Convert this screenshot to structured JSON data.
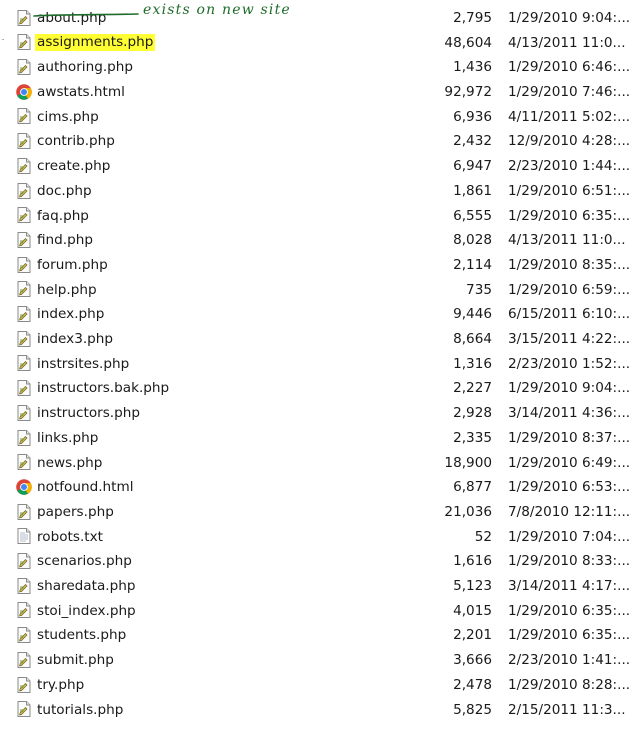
{
  "files": [
    {
      "name": "about.php",
      "size": "2,795",
      "date": "1/29/2010 9:04:...",
      "icon": "php-file-icon"
    },
    {
      "name": "assignments.php",
      "size": "48,604",
      "date": "4/13/2011 11:0...",
      "icon": "php-file-icon",
      "highlighted": true
    },
    {
      "name": "authoring.php",
      "size": "1,436",
      "date": "1/29/2010 6:46:...",
      "icon": "php-file-icon"
    },
    {
      "name": "awstats.html",
      "size": "92,972",
      "date": "1/29/2010 7:46:...",
      "icon": "chrome-icon"
    },
    {
      "name": "cims.php",
      "size": "6,936",
      "date": "4/11/2011 5:02:...",
      "icon": "php-file-icon"
    },
    {
      "name": "contrib.php",
      "size": "2,432",
      "date": "12/9/2010 4:28:...",
      "icon": "php-file-icon"
    },
    {
      "name": "create.php",
      "size": "6,947",
      "date": "2/23/2010 1:44:...",
      "icon": "php-file-icon"
    },
    {
      "name": "doc.php",
      "size": "1,861",
      "date": "1/29/2010 6:51:...",
      "icon": "php-file-icon"
    },
    {
      "name": "faq.php",
      "size": "6,555",
      "date": "1/29/2010 6:35:...",
      "icon": "php-file-icon"
    },
    {
      "name": "find.php",
      "size": "8,028",
      "date": "4/13/2011 11:0...",
      "icon": "php-file-icon"
    },
    {
      "name": "forum.php",
      "size": "2,114",
      "date": "1/29/2010 8:35:...",
      "icon": "php-file-icon"
    },
    {
      "name": "help.php",
      "size": "735",
      "date": "1/29/2010 6:59:...",
      "icon": "php-file-icon"
    },
    {
      "name": "index.php",
      "size": "9,446",
      "date": "6/15/2011 6:10:...",
      "icon": "php-file-icon"
    },
    {
      "name": "index3.php",
      "size": "8,664",
      "date": "3/15/2011 4:22:...",
      "icon": "php-file-icon"
    },
    {
      "name": "instrsites.php",
      "size": "1,316",
      "date": "2/23/2010 1:52:...",
      "icon": "php-file-icon"
    },
    {
      "name": "instructors.bak.php",
      "size": "2,227",
      "date": "1/29/2010 9:04:...",
      "icon": "php-file-icon"
    },
    {
      "name": "instructors.php",
      "size": "2,928",
      "date": "3/14/2011 4:36:...",
      "icon": "php-file-icon"
    },
    {
      "name": "links.php",
      "size": "2,335",
      "date": "1/29/2010 8:37:...",
      "icon": "php-file-icon"
    },
    {
      "name": "news.php",
      "size": "18,900",
      "date": "1/29/2010 6:49:...",
      "icon": "php-file-icon"
    },
    {
      "name": "notfound.html",
      "size": "6,877",
      "date": "1/29/2010 6:53:...",
      "icon": "chrome-icon"
    },
    {
      "name": "papers.php",
      "size": "21,036",
      "date": "7/8/2010 12:11:...",
      "icon": "php-file-icon"
    },
    {
      "name": "robots.txt",
      "size": "52",
      "date": "1/29/2010 7:04:...",
      "icon": "text-file-icon"
    },
    {
      "name": "scenarios.php",
      "size": "1,616",
      "date": "1/29/2010 8:33:...",
      "icon": "php-file-icon"
    },
    {
      "name": "sharedata.php",
      "size": "5,123",
      "date": "3/14/2011 4:17:...",
      "icon": "php-file-icon"
    },
    {
      "name": "stoi_index.php",
      "size": "4,015",
      "date": "1/29/2010 6:35:...",
      "icon": "php-file-icon"
    },
    {
      "name": "students.php",
      "size": "2,201",
      "date": "1/29/2010 6:35:...",
      "icon": "php-file-icon"
    },
    {
      "name": "submit.php",
      "size": "3,666",
      "date": "2/23/2010 1:41:...",
      "icon": "php-file-icon"
    },
    {
      "name": "try.php",
      "size": "2,478",
      "date": "1/29/2010 8:28:...",
      "icon": "php-file-icon"
    },
    {
      "name": "tutorials.php",
      "size": "5,825",
      "date": "2/15/2011 11:3...",
      "icon": "php-file-icon"
    }
  ],
  "annotation": {
    "text": "exists on new site",
    "color": "#1e6b2a"
  },
  "colors": {
    "highlight": "#ffff33"
  }
}
